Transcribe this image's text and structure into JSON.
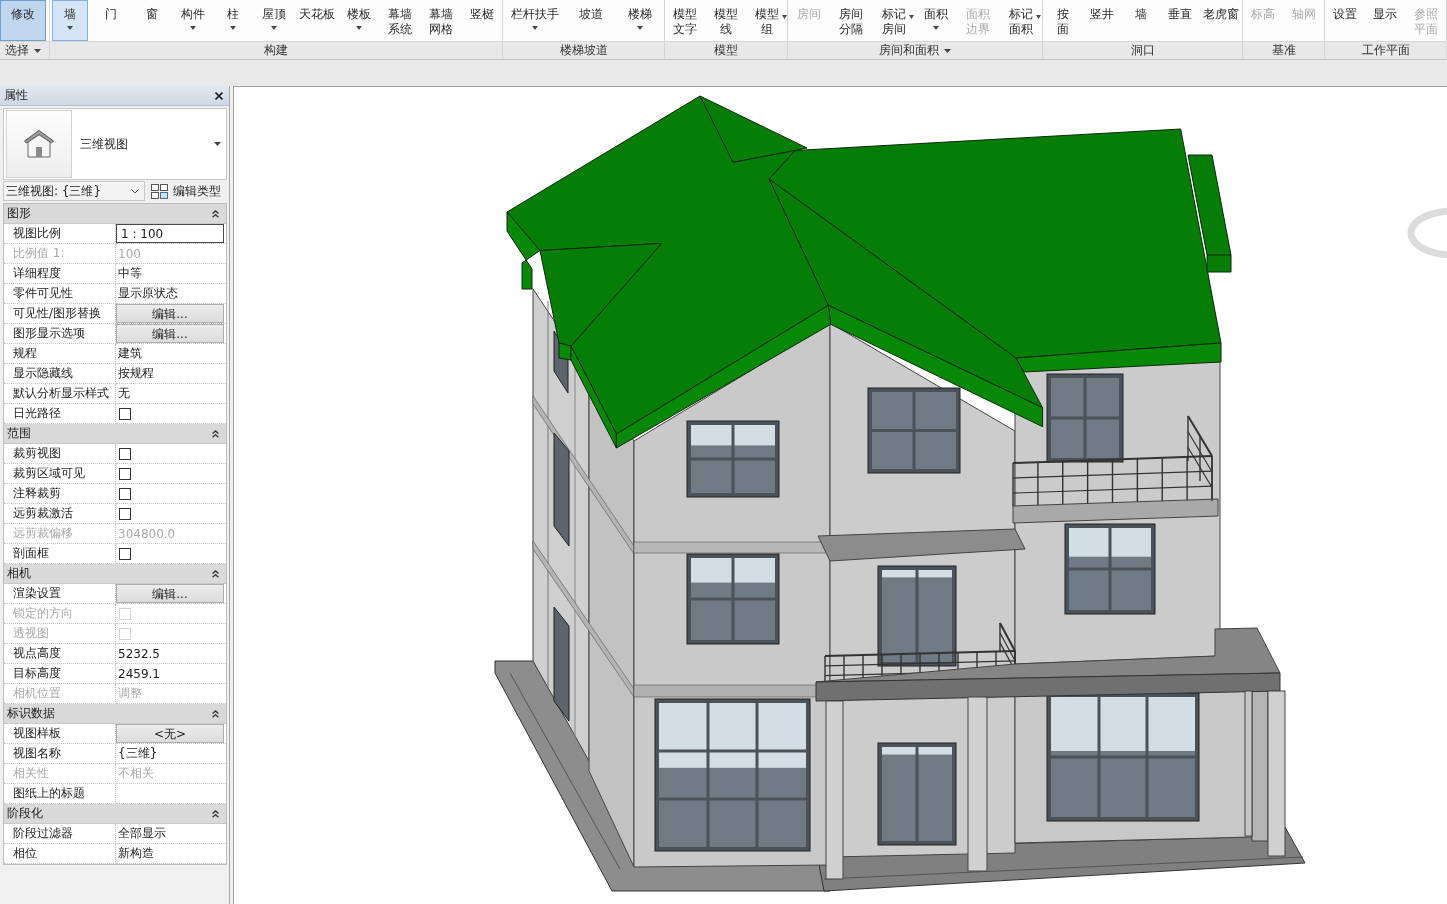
{
  "ribbon": {
    "panels": [
      {
        "title": "选择",
        "menu": true,
        "items": [
          {
            "label": "修改",
            "selected": true,
            "disabled": false,
            "dropdown": false,
            "wrap": false
          }
        ]
      },
      {
        "title": "构建",
        "menu": false,
        "items": [
          {
            "label": "墙",
            "selected": true,
            "disabled": false,
            "dropdown": true,
            "wrap": false
          },
          {
            "label": "门",
            "selected": false,
            "disabled": false,
            "dropdown": false
          },
          {
            "label": "窗",
            "selected": false,
            "disabled": false,
            "dropdown": false
          },
          {
            "label": "构件",
            "selected": false,
            "disabled": false,
            "dropdown": true,
            "wrap": false
          },
          {
            "label": "柱",
            "selected": false,
            "disabled": false,
            "dropdown": true,
            "wrap": false
          },
          {
            "label": "屋顶",
            "selected": false,
            "disabled": false,
            "dropdown": true,
            "wrap": false
          },
          {
            "label": "天花板",
            "selected": false,
            "disabled": false,
            "dropdown": false,
            "wrap": false
          },
          {
            "label": "楼板",
            "selected": false,
            "disabled": false,
            "dropdown": true,
            "wrap": false
          },
          {
            "label": "幕墙系统",
            "selected": false,
            "disabled": false,
            "dropdown": false,
            "wrap": true
          },
          {
            "label": "幕墙网格",
            "selected": false,
            "disabled": false,
            "dropdown": false,
            "wrap": true
          },
          {
            "label": "竖梃",
            "selected": false,
            "disabled": false,
            "dropdown": false,
            "wrap": false
          }
        ]
      },
      {
        "title": "楼梯坡道",
        "menu": false,
        "items": [
          {
            "label": "栏杆扶手",
            "selected": false,
            "disabled": false,
            "dropdown": true,
            "wrap": false
          },
          {
            "label": "坡道",
            "selected": false,
            "disabled": false,
            "dropdown": false,
            "wrap": false
          },
          {
            "label": "楼梯",
            "selected": false,
            "disabled": false,
            "dropdown": true,
            "wrap": false
          }
        ]
      },
      {
        "title": "模型",
        "menu": false,
        "items": [
          {
            "label": "模型文字",
            "selected": false,
            "disabled": false,
            "dropdown": false,
            "wrap": true
          },
          {
            "label": "模型线",
            "selected": false,
            "disabled": false,
            "dropdown": false,
            "wrap": true
          },
          {
            "label": "模型组",
            "selected": false,
            "disabled": false,
            "dropdown": true,
            "wrap": true
          }
        ]
      },
      {
        "title": "房间和面积",
        "menu": true,
        "items": [
          {
            "label": "房间",
            "selected": false,
            "disabled": true,
            "dropdown": false,
            "wrap": false
          },
          {
            "label": "房间分隔",
            "selected": false,
            "disabled": false,
            "dropdown": false,
            "wrap": true
          },
          {
            "label": "标记房间",
            "selected": false,
            "disabled": false,
            "dropdown": true,
            "wrap": true
          },
          {
            "label": "面积",
            "selected": false,
            "disabled": false,
            "dropdown": true,
            "wrap": false
          },
          {
            "label": "面积边界",
            "selected": false,
            "disabled": true,
            "dropdown": false,
            "wrap": true
          },
          {
            "label": "标记面积",
            "selected": false,
            "disabled": false,
            "dropdown": true,
            "wrap": true
          }
        ]
      },
      {
        "title": "洞口",
        "menu": false,
        "items": [
          {
            "label": "按面",
            "selected": false,
            "disabled": false,
            "dropdown": false,
            "wrap": true
          },
          {
            "label": "竖井",
            "selected": false,
            "disabled": false,
            "dropdown": false,
            "wrap": false
          },
          {
            "label": "墙",
            "selected": false,
            "disabled": false,
            "dropdown": false
          },
          {
            "label": "垂直",
            "selected": false,
            "disabled": false,
            "dropdown": false,
            "wrap": false
          },
          {
            "label": "老虎窗",
            "selected": false,
            "disabled": false,
            "dropdown": false,
            "wrap": false
          }
        ]
      },
      {
        "title": "基准",
        "menu": false,
        "items": [
          {
            "label": "标高",
            "selected": false,
            "disabled": true,
            "dropdown": false,
            "wrap": false
          },
          {
            "label": "轴网",
            "selected": false,
            "disabled": true,
            "dropdown": false,
            "wrap": false
          }
        ]
      },
      {
        "title": "工作平面",
        "menu": false,
        "items": [
          {
            "label": "设置",
            "selected": false,
            "disabled": false,
            "dropdown": false,
            "wrap": false
          },
          {
            "label": "显示",
            "selected": false,
            "disabled": false,
            "dropdown": false,
            "wrap": false
          },
          {
            "label": "参照平面",
            "selected": false,
            "disabled": true,
            "dropdown": false,
            "wrap": true
          }
        ]
      }
    ]
  },
  "properties": {
    "title": "属性",
    "type_name": "三维视图",
    "instance": "三维视图: {三维}",
    "edit_type": "编辑类型",
    "sections": [
      {
        "title": "图形",
        "expanded": true,
        "rows": [
          {
            "label": "视图比例",
            "kind": "field",
            "value": "1 : 100",
            "disabled": false
          },
          {
            "label": "比例值 1:",
            "kind": "text",
            "value": "100",
            "disabled": true
          },
          {
            "label": "详细程度",
            "kind": "text",
            "value": "中等",
            "disabled": false
          },
          {
            "label": "零件可见性",
            "kind": "text",
            "value": "显示原状态",
            "disabled": false
          },
          {
            "label": "可见性/图形替换",
            "kind": "button",
            "value": "编辑...",
            "disabled": false
          },
          {
            "label": "图形显示选项",
            "kind": "button",
            "value": "编辑...",
            "disabled": false
          },
          {
            "label": "规程",
            "kind": "text",
            "value": "建筑",
            "disabled": false
          },
          {
            "label": "显示隐藏线",
            "kind": "text",
            "value": "按规程",
            "disabled": false
          },
          {
            "label": "默认分析显示样式",
            "kind": "text",
            "value": "无",
            "disabled": false
          },
          {
            "label": "日光路径",
            "kind": "checkbox",
            "checked": false,
            "disabled": false
          }
        ]
      },
      {
        "title": "范围",
        "expanded": true,
        "rows": [
          {
            "label": "裁剪视图",
            "kind": "checkbox",
            "checked": false,
            "disabled": false
          },
          {
            "label": "裁剪区域可见",
            "kind": "checkbox",
            "checked": false,
            "disabled": false
          },
          {
            "label": "注释裁剪",
            "kind": "checkbox",
            "checked": false,
            "disabled": false
          },
          {
            "label": "远剪裁激活",
            "kind": "checkbox",
            "checked": false,
            "disabled": false
          },
          {
            "label": "远剪裁偏移",
            "kind": "text",
            "value": "304800.0",
            "disabled": true
          },
          {
            "label": "剖面框",
            "kind": "checkbox",
            "checked": false,
            "disabled": false
          }
        ]
      },
      {
        "title": "相机",
        "expanded": true,
        "rows": [
          {
            "label": "渲染设置",
            "kind": "button",
            "value": "编辑...",
            "disabled": false
          },
          {
            "label": "锁定的方向",
            "kind": "checkbox",
            "checked": false,
            "disabled": true
          },
          {
            "label": "透视图",
            "kind": "checkbox",
            "checked": false,
            "disabled": true
          },
          {
            "label": "视点高度",
            "kind": "text",
            "value": "5232.5",
            "disabled": false
          },
          {
            "label": "目标高度",
            "kind": "text",
            "value": "2459.1",
            "disabled": false
          },
          {
            "label": "相机位置",
            "kind": "text",
            "value": "调整",
            "disabled": true
          }
        ]
      },
      {
        "title": "标识数据",
        "expanded": true,
        "rows": [
          {
            "label": "视图样板",
            "kind": "button",
            "value": "<无>",
            "disabled": false
          },
          {
            "label": "视图名称",
            "kind": "text",
            "value": "{三维}",
            "disabled": false
          },
          {
            "label": "相关性",
            "kind": "text",
            "value": "不相关",
            "disabled": true
          },
          {
            "label": "图纸上的标题",
            "kind": "text",
            "disabled": false
          }
        ]
      },
      {
        "title": "阶段化",
        "expanded": true,
        "rows": [
          {
            "label": "阶段过滤器",
            "kind": "text",
            "value": "全部显示",
            "disabled": false
          },
          {
            "label": "相位",
            "kind": "text",
            "value": "新构造",
            "disabled": false
          }
        ]
      }
    ]
  }
}
